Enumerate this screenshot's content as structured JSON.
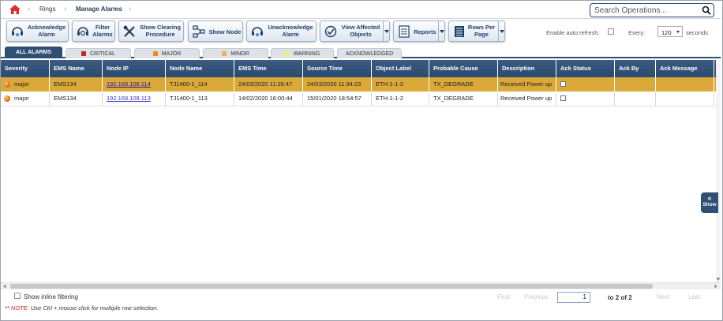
{
  "breadcrumb": {
    "items": [
      "Rings",
      "Manage Alarms"
    ]
  },
  "search": {
    "placeholder": "Search Operations..."
  },
  "toolbar": {
    "buttons": [
      {
        "label_line1": "Acknowledge",
        "label_line2": "Alarm",
        "icon": "acknowledge-headset-icon"
      },
      {
        "label_line1": "Filter",
        "label_line2": "Alarms",
        "icon": "filter-alarms-icon"
      },
      {
        "label_line1": "Show Clearing",
        "label_line2": "Procedure",
        "icon": "tools-icon"
      },
      {
        "label_line1": "Show Node",
        "label_line2": "",
        "icon": "node-topology-icon"
      },
      {
        "label_line1": "Unacknowledge",
        "label_line2": "Alarm",
        "icon": "unacknowledge-headset-icon"
      },
      {
        "label_line1": "View Affected",
        "label_line2": "Objects",
        "icon": "view-objects-icon"
      },
      {
        "label_line1": "Reports",
        "label_line2": "",
        "icon": "reports-icon"
      },
      {
        "label_line1": "Rows Per",
        "label_line2": "Page",
        "icon": "rows-per-page-icon"
      }
    ],
    "auto_refresh_label": "Enable auto refresh:",
    "every_label": "Every:",
    "interval_value": "120",
    "seconds_label": "seconds"
  },
  "tabs": [
    {
      "label": "ALL ALARMS",
      "color": null,
      "active": true
    },
    {
      "label": "CRITICAL",
      "color": "#c0282d",
      "active": false
    },
    {
      "label": "MAJOR",
      "color": "#f08a1c",
      "active": false
    },
    {
      "label": "MINOR",
      "color": "#e6b25a",
      "active": false
    },
    {
      "label": "WARNING",
      "color": "#f5ee6a",
      "active": false
    },
    {
      "label": "ACKNOWLEDGED",
      "color": null,
      "active": false
    }
  ],
  "grid": {
    "columns": [
      "Severity",
      "EMS Name",
      "Node IP",
      "Node Name",
      "EMS Time",
      "Source Time",
      "Object Label",
      "Probable Cause",
      "Description",
      "Ack Status",
      "Ack By",
      "Ack Message"
    ],
    "rows": [
      {
        "selected": true,
        "severity": "major",
        "ems_name": "EMS134",
        "node_ip": "192.168.108.114",
        "node_name": "TJ1400-1_114",
        "ems_time": "24/03/2020 11:26:47",
        "source_time": "24/03/2020 11:34:23",
        "object_label": "ETH-1-1-2",
        "probable_cause": "TX_DEGRADE",
        "description": "Received Power up",
        "ack_by": "",
        "ack_message": ""
      },
      {
        "selected": false,
        "severity": "major",
        "ems_name": "EMS134",
        "node_ip": "192.168.108.113",
        "node_name": "TJ1400-1_113",
        "ems_time": "14/02/2020 16:00:44",
        "source_time": "15/01/2020 18:54:57",
        "object_label": "ETH-1-1-2",
        "probable_cause": "TX_DEGRADE",
        "description": "Received Power up",
        "ack_by": "",
        "ack_message": ""
      }
    ],
    "side_button_label": "Show"
  },
  "footer": {
    "inline_filter_label": "Show inline filtering",
    "note_prefix": "** ",
    "note_label": "NOTE:",
    "note_text": " Use Ctrl + mouse click for multiple row selection.",
    "pager": {
      "first": "First",
      "previous": "Previous",
      "page_value": "1",
      "total": "to 2 of 2",
      "next": "Next",
      "last": "Last"
    }
  },
  "colors": {
    "header": "#2f4f75",
    "selected_row": "#daa93a",
    "link": "#3a34c9"
  }
}
